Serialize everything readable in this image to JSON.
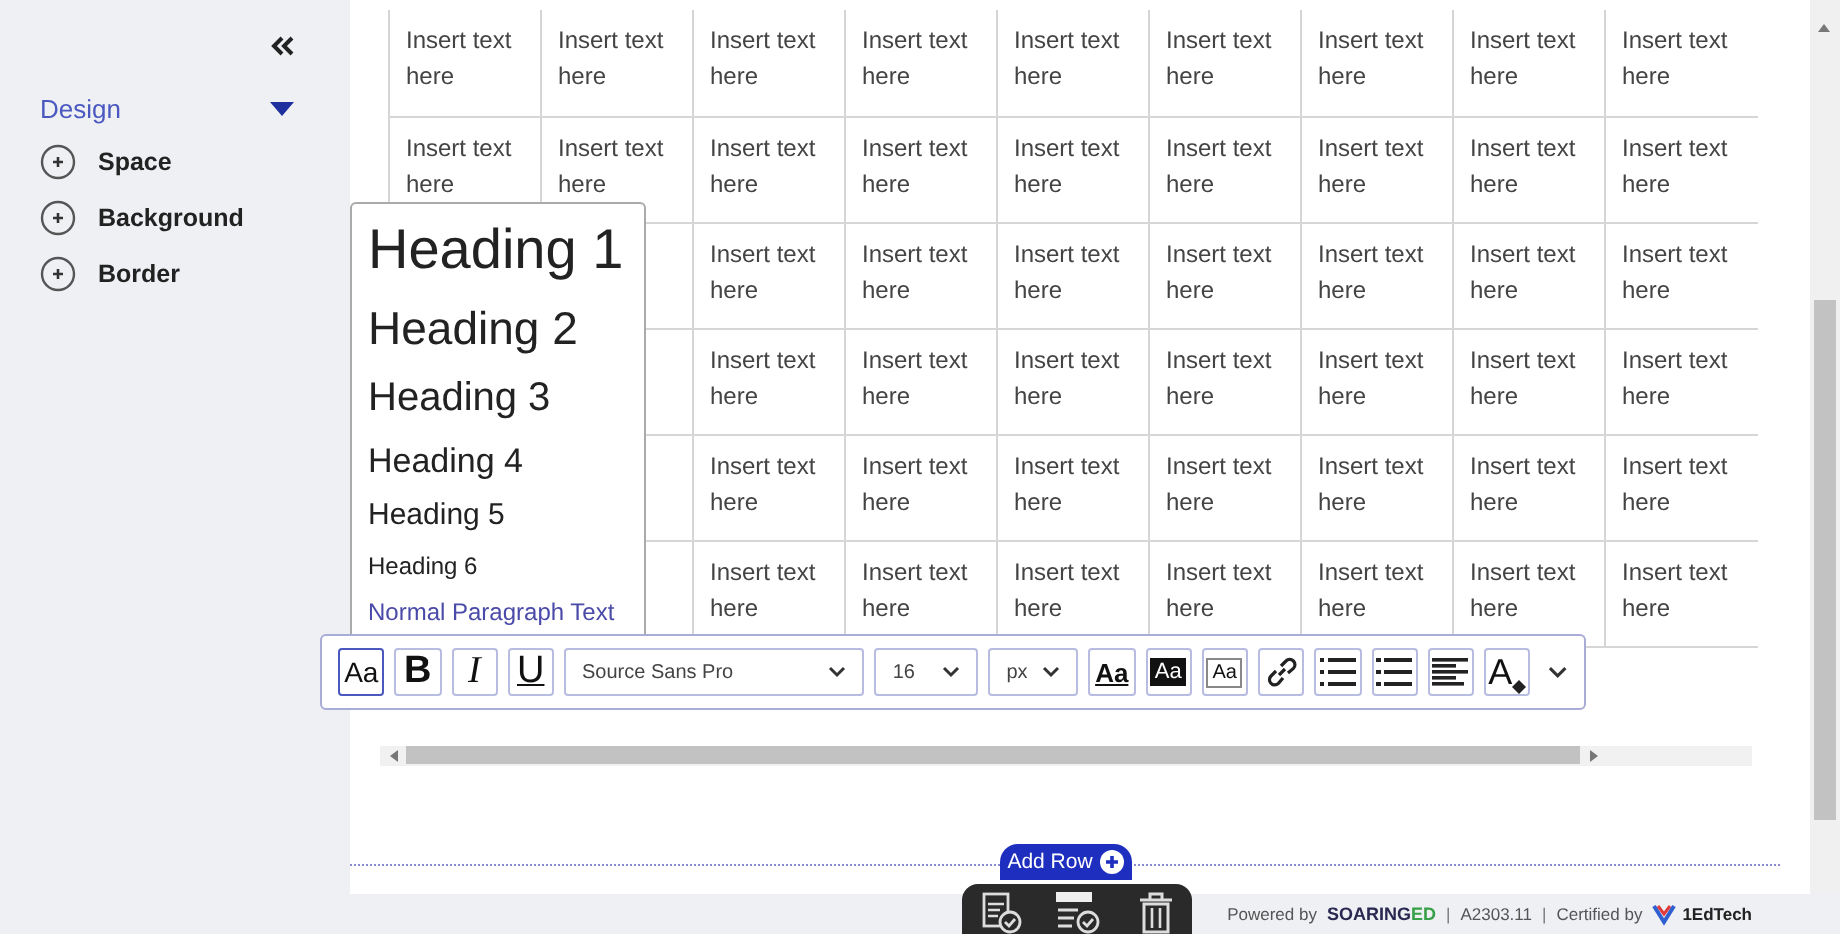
{
  "sidebar": {
    "section": {
      "label": "Design",
      "expanded": true
    },
    "items": [
      {
        "label": "Space"
      },
      {
        "label": "Background"
      },
      {
        "label": "Border"
      }
    ]
  },
  "table": {
    "rows": [
      {
        "cells": [
          {
            "text": "Insert text here"
          },
          {
            "text": "Insert text here"
          },
          {
            "text": "Insert text here"
          },
          {
            "text": "Insert text here"
          },
          {
            "text": "Insert text here"
          },
          {
            "text": "Insert text here"
          },
          {
            "text": "Insert text here"
          },
          {
            "text": "Insert text here"
          },
          {
            "text": "Insert text here"
          }
        ]
      },
      {
        "cells": [
          {
            "text": "Insert text here"
          },
          {
            "text": "Insert text here"
          },
          {
            "text": "Insert text here"
          },
          {
            "text": "Insert text here"
          },
          {
            "text": "Insert text here"
          },
          {
            "text": "Insert text here"
          },
          {
            "text": "Insert text here"
          },
          {
            "text": "Insert text here"
          },
          {
            "text": "Insert text here"
          }
        ]
      },
      {
        "cells": [
          {},
          {},
          {
            "text": "Insert text here"
          },
          {
            "text": "Insert text here"
          },
          {
            "text": "Insert text here"
          },
          {
            "text": "Insert text here"
          },
          {
            "text": "Insert text here"
          },
          {
            "text": "Insert text here"
          },
          {
            "text": "Insert text here"
          }
        ]
      },
      {
        "cells": [
          {},
          {},
          {
            "text": "Insert text here"
          },
          {
            "text": "Insert text here"
          },
          {
            "text": "Insert text here"
          },
          {
            "text": "Insert text here"
          },
          {
            "text": "Insert text here"
          },
          {
            "text": "Insert text here"
          },
          {
            "text": "Insert text here"
          }
        ]
      },
      {
        "cells": [
          {},
          {},
          {
            "text": "Insert text here"
          },
          {
            "text": "Insert text here"
          },
          {
            "text": "Insert text here"
          },
          {
            "text": "Insert text here"
          },
          {
            "text": "Insert text here"
          },
          {
            "text": "Insert text here"
          },
          {
            "text": "Insert text here"
          }
        ]
      },
      {
        "cells": [
          {},
          {},
          {
            "text": "Insert text here"
          },
          {
            "text": "Insert text here"
          },
          {
            "text": "Insert text here"
          },
          {
            "text": "Insert text here"
          },
          {
            "text": "Insert text here"
          },
          {
            "text": "Insert text here"
          },
          {
            "text": "Insert text here"
          }
        ]
      }
    ]
  },
  "heading_menu": {
    "items": [
      {
        "label": "Heading 1",
        "kind": "h1"
      },
      {
        "label": "Heading 2",
        "kind": "h2"
      },
      {
        "label": "Heading 3",
        "kind": "h3"
      },
      {
        "label": "Heading 4",
        "kind": "h4"
      },
      {
        "label": "Heading 5",
        "kind": "h5"
      },
      {
        "label": "Heading 6",
        "kind": "h6"
      },
      {
        "label": "Normal Paragraph Text",
        "kind": "p"
      }
    ]
  },
  "toolbar": {
    "style_buttons": [
      {
        "label": "Aa",
        "kind": "style",
        "selected": true
      },
      {
        "label": "B",
        "kind": "bold",
        "selected": false
      },
      {
        "label": "I",
        "kind": "italic",
        "selected": false
      },
      {
        "label": "U",
        "kind": "underline",
        "selected": false
      }
    ],
    "font": {
      "value": "Source Sans Pro"
    },
    "size": {
      "value": "16"
    },
    "unit": {
      "value": "px"
    },
    "format_buttons": [
      {
        "label": "Aa",
        "kind": "underline"
      },
      {
        "label": "Aa",
        "kind": "inverse"
      },
      {
        "label": "Aa",
        "kind": "boxed"
      },
      {
        "kind": "link"
      },
      {
        "kind": "bullets"
      },
      {
        "kind": "numbered"
      },
      {
        "kind": "align"
      },
      {
        "label": "A",
        "kind": "color"
      }
    ]
  },
  "add_row": {
    "label": "Add Row"
  },
  "footer": [
    {
      "text": "Powered by",
      "kind": "plain"
    },
    {
      "text": "SOARING",
      "kind": "brand"
    },
    {
      "text": "ED",
      "kind": "brand-accent"
    },
    {
      "text": "|",
      "kind": "separator"
    },
    {
      "text": "A2303.11",
      "kind": "plain"
    },
    {
      "text": "|",
      "kind": "separator"
    },
    {
      "text": "Certified by",
      "kind": "plain"
    },
    {
      "text": "1EdTech",
      "kind": "logo"
    }
  ]
}
